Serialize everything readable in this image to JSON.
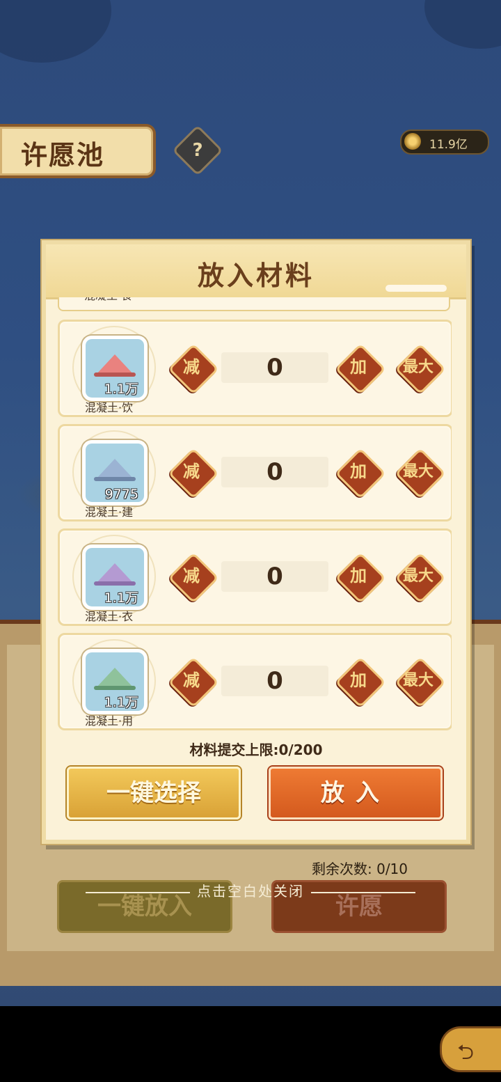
{
  "background": {
    "title": "许愿池",
    "help_symbol": "?",
    "currency_value": "11.9亿",
    "remaining_label": "剩余次数: 0/10",
    "buttons": {
      "auto_put": "一键放入",
      "wish": "许愿"
    },
    "close_hint": "点击空白处关闭"
  },
  "modal": {
    "title": "放入材料",
    "partial_item_name": "混凝土·食",
    "items": [
      {
        "name": "混凝土·饮",
        "count": "1.1万",
        "quantity": "0",
        "pile_color": "#e9827f",
        "pile_shadow": "#b85552",
        "icon_bg": "#a9d2e3"
      },
      {
        "name": "混凝土·建",
        "count": "9775",
        "quantity": "0",
        "pile_color": "#9bb3d3",
        "pile_shadow": "#6e86a8",
        "icon_bg": "#a9d2e3"
      },
      {
        "name": "混凝土·衣",
        "count": "1.1万",
        "quantity": "0",
        "pile_color": "#b49ad2",
        "pile_shadow": "#8a6eaa",
        "icon_bg": "#a9d2e3"
      },
      {
        "name": "混凝土·用",
        "count": "1.1万",
        "quantity": "0",
        "pile_color": "#8fc29b",
        "pile_shadow": "#5f9670",
        "icon_bg": "#a9d2e3"
      }
    ],
    "controls": {
      "minus": "减",
      "plus": "加",
      "max": "最大"
    },
    "limit_text": "材料提交上限:0/200",
    "select_button": "一键选择",
    "put_button": "放入"
  },
  "icons": {
    "help": "help-icon",
    "coin": "coin-icon",
    "back": "back-arrow-icon"
  }
}
